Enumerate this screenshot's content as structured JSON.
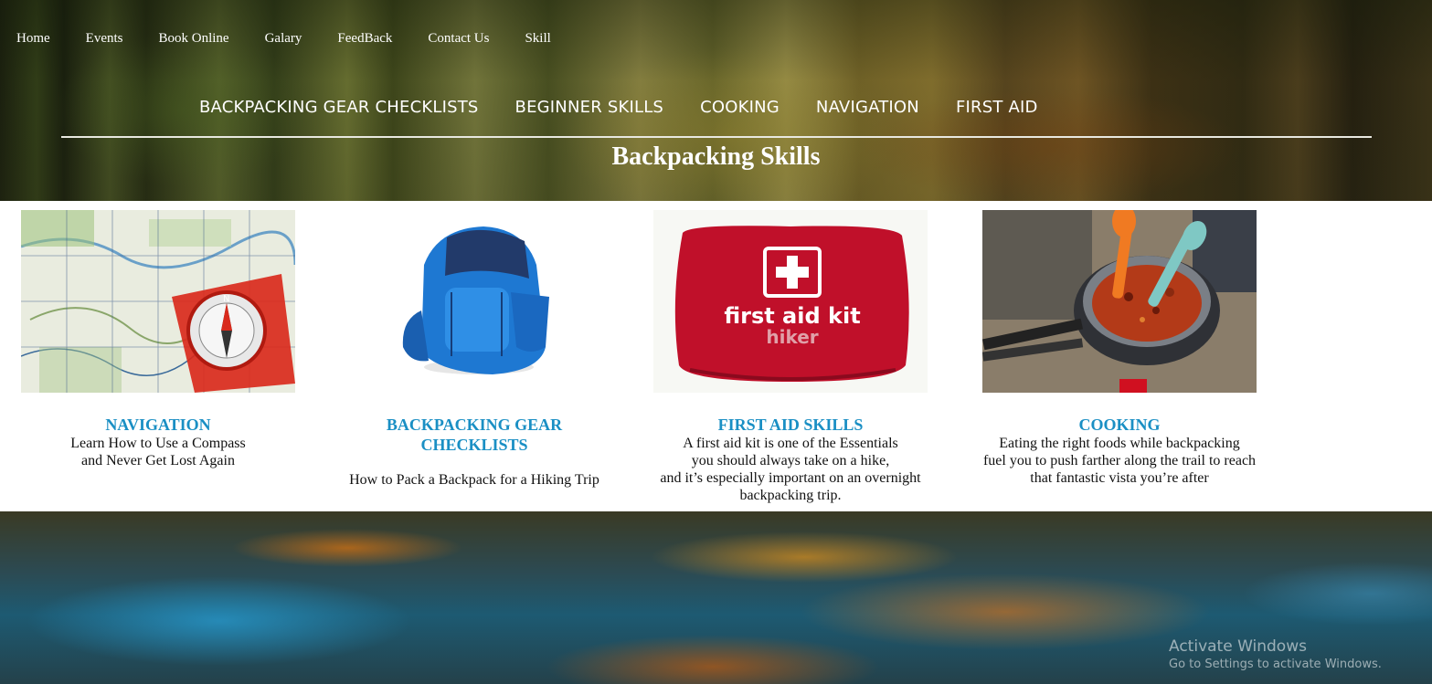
{
  "top_nav": {
    "items": [
      "Home",
      "Events",
      "Book Online",
      "Galary",
      "FeedBack",
      "Contact Us",
      "Skill"
    ]
  },
  "sub_nav": {
    "items": [
      "BACKPACKING GEAR CHECKLISTS",
      "BEGINNER SKILLS",
      "COOKING",
      "NAVIGATION",
      "FIRST AID"
    ]
  },
  "page": {
    "title": "Backpacking Skills"
  },
  "cards": [
    {
      "title": "NAVIGATION",
      "desc": [
        "Learn How to Use a Compass",
        "and Never Get Lost Again"
      ],
      "image_icon": "map-compass-image"
    },
    {
      "title_lines": [
        "BACKPACKING GEAR",
        "CHECKLISTS"
      ],
      "desc": [
        "How to Pack a Backpack for a Hiking Trip"
      ],
      "image_icon": "backpack-image"
    },
    {
      "title": "FIRST AID SKILLS",
      "desc": [
        "A first aid kit is one of the Essentials",
        "you should always take on a hike,",
        "and it’s especially important on an overnight",
        "backpacking trip."
      ],
      "image_icon": "first-aid-kit-image",
      "kit_text": [
        "first aid kit",
        "hiker"
      ]
    },
    {
      "title": "COOKING",
      "desc": [
        "Eating the right foods while backpacking",
        "fuel you to push farther along the trail to reach",
        "that fantastic vista you’re after"
      ],
      "image_icon": "camp-cooking-image"
    }
  ],
  "watermark": {
    "line1": "Activate Windows",
    "line2": "Go to Settings to activate Windows."
  },
  "colors": {
    "card_title": "#1a8fc4",
    "kit_red": "#c0102a",
    "backpack_blue": "#1e78d2"
  }
}
